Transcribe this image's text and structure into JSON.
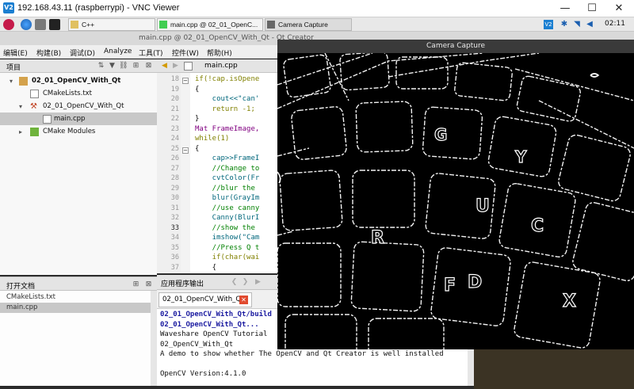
{
  "vnc": {
    "title": "192.168.43.11 (raspberrypi) - VNC Viewer",
    "logo": "V2"
  },
  "window_controls": {
    "minimize": "—",
    "maximize": "☐",
    "close": "✕"
  },
  "taskbar": {
    "tasks": [
      {
        "label": "C++",
        "icon": "folder-icon"
      },
      {
        "label": "main.cpp @ 02_01_OpenC...",
        "icon": "qt-icon"
      },
      {
        "label": "Camera Capture",
        "icon": "window-icon"
      }
    ],
    "clock": "02:11"
  },
  "qt_window_title": "main.cpp @ 02_01_OpenCV_With_Qt - Qt Creator",
  "menu": [
    "编辑(E)",
    "构建(B)",
    "调试(D)",
    "Analyze",
    "工具(T)",
    "控件(W)",
    "帮助(H)"
  ],
  "project_pane": {
    "header": "项目",
    "tree": [
      {
        "label": "02_01_OpenCV_With_Qt",
        "icon": "project-icon"
      },
      {
        "label": "CMakeLists.txt",
        "icon": "cmake-file-icon"
      },
      {
        "label": "02_01_OpenCV_With_Qt",
        "icon": "build-target-icon"
      },
      {
        "label": "main.cpp",
        "icon": "cpp-file-icon"
      },
      {
        "label": "CMake Modules",
        "icon": "cmake-modules-icon"
      }
    ]
  },
  "open_docs": {
    "header": "打开文档",
    "items": [
      "CMakeLists.txt",
      "main.cpp"
    ]
  },
  "editor": {
    "file_tab": "main.cpp",
    "line_numbers": [
      "18",
      "19",
      "20",
      "21",
      "22",
      "23",
      "24",
      "25",
      "26",
      "27",
      "28",
      "29",
      "30",
      "31",
      "32",
      "33",
      "34",
      "35",
      "36",
      "37"
    ],
    "current_line": "33",
    "lines": [
      "if(!cap.isOpene",
      "{",
      "    cout<<\"can'",
      "    return -1;",
      "}",
      "Mat FrameImage,",
      "while(1)",
      "{",
      "    cap>>FrameI",
      "    //Change to",
      "    cvtColor(Fr",
      "    //blur the ",
      "    blur(GrayIm",
      "    //use canny",
      "    Canny(BlurI",
      "    //show the ",
      "    imshow(\"Cam",
      "    //Press Q t",
      "    if(char(wai",
      "    {"
    ]
  },
  "output_pane": {
    "header": "应用程序输出",
    "tab": "02_01_OpenCV_With_Qt",
    "lines": [
      "02_01_OpenCV_With_Qt/build",
      "02_01_OpenCV_With_Qt...",
      "Waveshare OpenCV Tutorial",
      "02_OpenCV_With_Qt",
      "A demo to show whether The OpenCV and Qt Creator is well installed",
      "",
      "OpenCV Version:4.1.0"
    ]
  },
  "camera": {
    "title": "Camera Capture",
    "key_letters": [
      "G",
      "Y",
      "R",
      "U",
      "F",
      "D",
      "X",
      "C"
    ]
  },
  "colors": {
    "accent": "#1b7fd1",
    "selection": "#c8c8c8",
    "camera_bg": "#000000"
  }
}
